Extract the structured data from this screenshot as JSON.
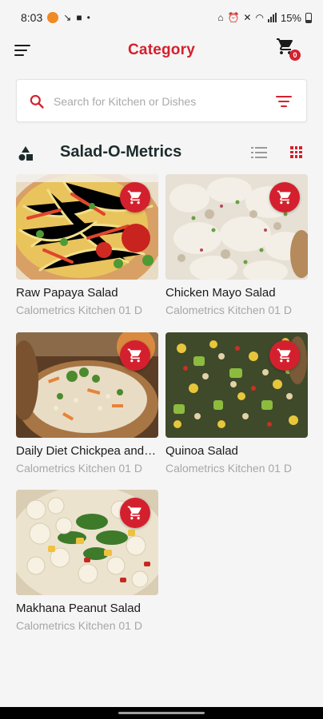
{
  "status_bar": {
    "time": "8:03",
    "battery": "15%"
  },
  "header": {
    "title": "Category",
    "cart_count": "0"
  },
  "search": {
    "placeholder": "Search for Kitchen or Dishes"
  },
  "section": {
    "title": "Salad-O-Metrics"
  },
  "colors": {
    "accent": "#d4202e",
    "background": "#f5f5f5",
    "muted_text": "#a7a7a7"
  },
  "icons": {
    "menu": "hamburger-menu-icon",
    "cart": "shopping-cart-icon",
    "search": "search-icon",
    "filter": "filter-icon",
    "category": "shapes-icon",
    "list_view": "list-view-icon",
    "grid_view": "grid-view-icon",
    "add_to_cart": "add-cart-icon"
  },
  "dishes": [
    {
      "name": "Raw Papaya Salad",
      "kitchen": "Calometrics Kitchen 01 D"
    },
    {
      "name": "Chicken Mayo Salad",
      "kitchen": "Calometrics Kitchen 01 D"
    },
    {
      "name": "Daily Diet Chickpea and Carrot Salad",
      "kitchen": "Calometrics Kitchen 01 D"
    },
    {
      "name": "Quinoa Salad",
      "kitchen": "Calometrics Kitchen 01 D"
    },
    {
      "name": "Makhana Peanut Salad",
      "kitchen": "Calometrics Kitchen 01 D"
    }
  ]
}
